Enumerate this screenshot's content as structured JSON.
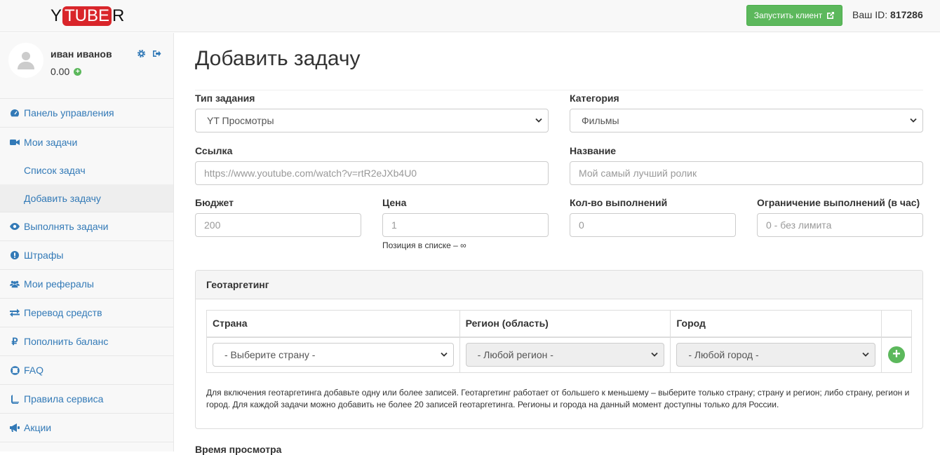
{
  "header": {
    "logo_left": "Y",
    "logo_mid": "TUBE",
    "logo_right": "R",
    "launch_label": "Запустить клиент",
    "user_id_label": "Ваш ID:",
    "user_id_value": "817286"
  },
  "profile": {
    "name": "иван иванов",
    "balance": "0.00"
  },
  "sidebar": {
    "items": [
      {
        "label": "Панель управления",
        "icon": "dashboard-icon"
      },
      {
        "label": "Мои задачи",
        "icon": "video-camera-icon"
      },
      {
        "label": "Список задач"
      },
      {
        "label": "Добавить задачу"
      },
      {
        "label": "Выполнять задачи",
        "icon": "eye-icon"
      },
      {
        "label": "Штрафы",
        "icon": "exclamation-icon"
      },
      {
        "label": "Мои рефералы",
        "icon": "users-icon"
      },
      {
        "label": "Перевод средств",
        "icon": "exchange-icon"
      },
      {
        "label": "Пополнить баланс",
        "icon": "ruble-icon"
      },
      {
        "label": "FAQ",
        "icon": "lifebuoy-icon"
      },
      {
        "label": "Правила сервиса",
        "icon": "book-icon"
      },
      {
        "label": "Акции",
        "icon": "bullhorn-icon"
      }
    ]
  },
  "main": {
    "title": "Добавить задачу",
    "task_type": {
      "label": "Тип задания",
      "value": "YT Просмотры"
    },
    "category": {
      "label": "Категория",
      "value": "Фильмы"
    },
    "link": {
      "label": "Ссылка",
      "placeholder": "https://www.youtube.com/watch?v=rtR2eJXb4U0"
    },
    "name": {
      "label": "Название",
      "placeholder": "Мой самый лучший ролик"
    },
    "budget": {
      "label": "Бюджет",
      "placeholder": "200"
    },
    "price": {
      "label": "Цена",
      "placeholder": "1",
      "help": "Позиция в списке – ∞"
    },
    "count": {
      "label": "Кол-во выполнений",
      "placeholder": "0"
    },
    "limit": {
      "label": "Ограничение выполнений (в час)",
      "placeholder": "0 - без лимита"
    }
  },
  "geo": {
    "title": "Геотаргетинг",
    "col_country": "Страна",
    "col_region": "Регион (область)",
    "col_city": "Город",
    "country_value": "- Выберите страну -",
    "region_value": "- Любой регион -",
    "city_value": "- Любой город -",
    "note": "Для включения геотаргетинга добавьте одну или более записей. Геотаргетинг работает от большего к меньшему – выберите только страну; страну и регион; либо страну, регион и город. Для каждой задачи можно добавить не более 20 записей геотаргетинга. Регионы и города на данный момент доступны только для России."
  },
  "next_section": "Время просмотра",
  "colors": {
    "link": "#337ab7",
    "success": "#5cb85c",
    "logo_red": "#d9252a"
  }
}
